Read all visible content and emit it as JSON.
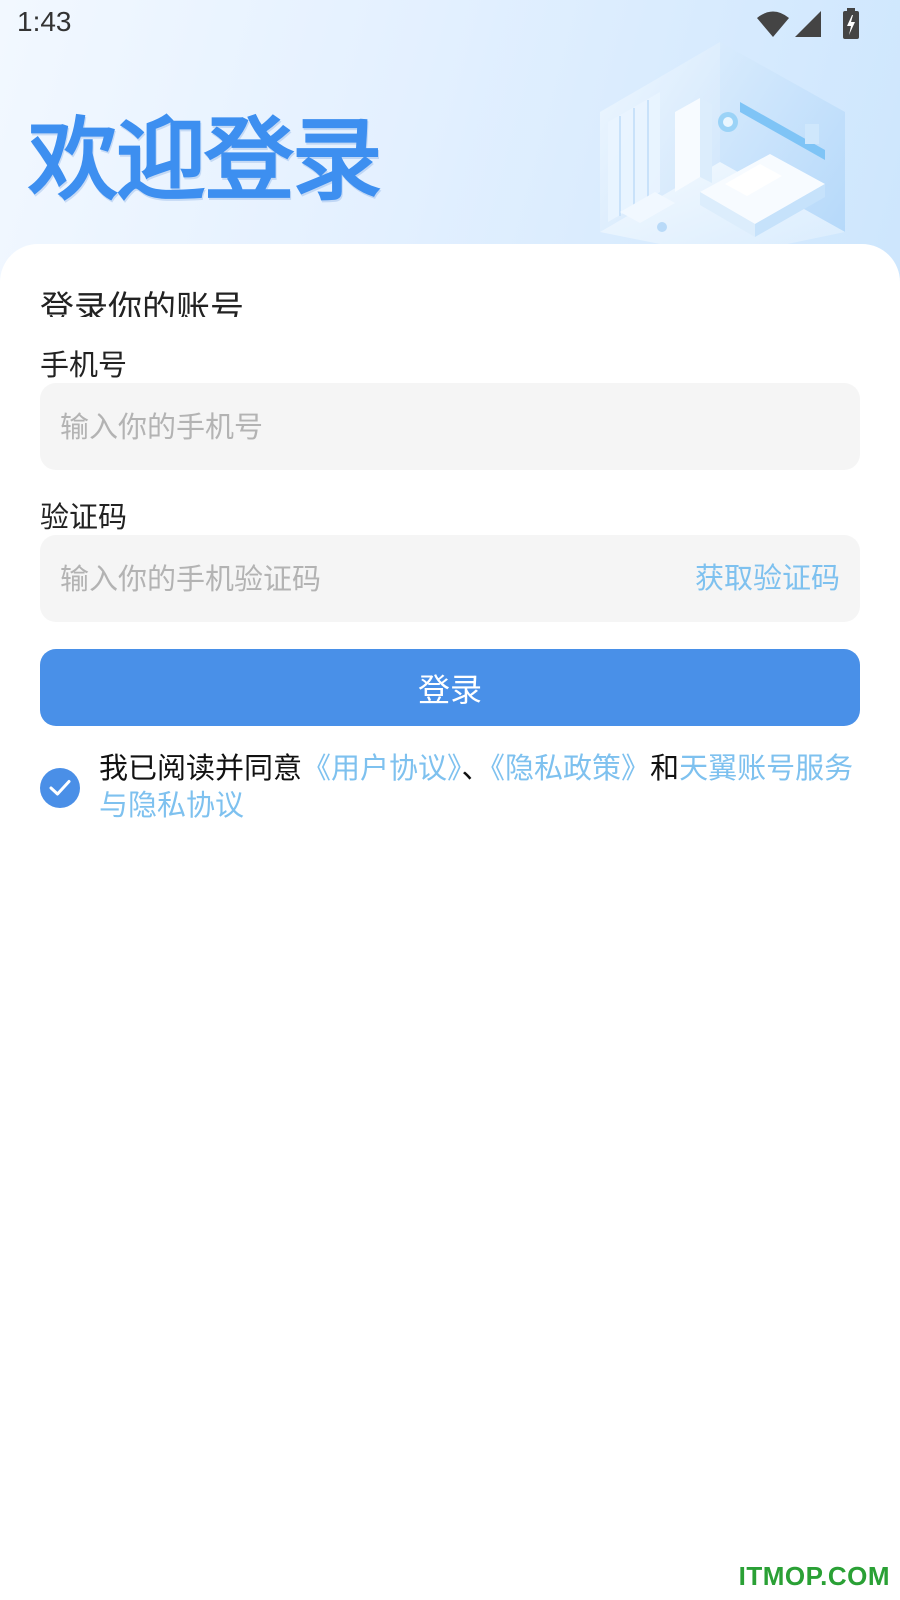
{
  "status_bar": {
    "time": "1:43",
    "icons": [
      "wifi-icon",
      "cellular-signal-icon",
      "battery-charging-icon"
    ]
  },
  "header": {
    "title": "欢迎登录",
    "illustration": "isometric-room-illustration"
  },
  "form": {
    "subtitle": "登录你的账号",
    "phone": {
      "label": "手机号",
      "value": "",
      "placeholder": "输入你的手机号"
    },
    "code": {
      "label": "验证码",
      "value": "",
      "placeholder": "输入你的手机验证码",
      "get_code_label": "获取验证码"
    },
    "login_label": "登录"
  },
  "agreement": {
    "checked": true,
    "prefix": "我已阅读并同意",
    "user_agreement": "《用户协议》",
    "separator": "、",
    "privacy_policy": "《隐私政策》",
    "conjunction": "和",
    "service_agreement": "天翼账号服务与隐私协议"
  },
  "watermark": "ITMOP.COM",
  "colors": {
    "primary": "#4990e8",
    "title": "#3d8ff0",
    "link": "#7ec1ef",
    "input_bg": "#f5f5f5",
    "watermark": "#2aa035"
  }
}
